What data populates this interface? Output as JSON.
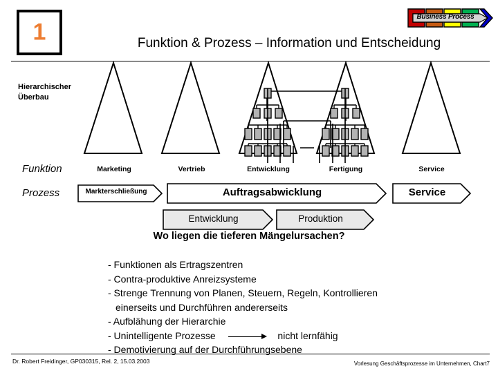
{
  "header": {
    "slide_number": "1",
    "slide_number_color": "#ED7D31",
    "title": "Funktion & Prozess – Information und Entscheidung",
    "logo_text": "Business Process",
    "logo_colors": [
      "#C00000",
      "#C55A11",
      "#FFFF00",
      "#00B050",
      "#0000CC"
    ]
  },
  "diagram": {
    "hierarchy_label": "Hierarchischer\nÜberbau",
    "hierarchy_label_line1": "Hierarchischer",
    "hierarchy_label_line2": "Überbau",
    "row_keys": {
      "function": "Funktion",
      "process": "Prozess"
    },
    "functions": [
      {
        "label": "Marketing",
        "has_orgchart": false
      },
      {
        "label": "Vertrieb",
        "has_orgchart": false
      },
      {
        "label": "Entwicklung",
        "has_orgchart": true
      },
      {
        "label": "Fertigung",
        "has_orgchart": true
      },
      {
        "label": "Service",
        "has_orgchart": false
      }
    ],
    "process_row_1": [
      {
        "label": "Markterschließung",
        "fill": "#ffffff",
        "font_size": "10px"
      },
      {
        "label": "Auftragsabwicklung",
        "fill": "#ffffff",
        "font_size": "15px"
      },
      {
        "label": "Service",
        "fill": "#ffffff",
        "font_size": "15px"
      }
    ],
    "process_row_2": [
      {
        "label": "Entwicklung",
        "fill": "#e9e9e9",
        "font_size": "13.5px"
      },
      {
        "label": "Produktion",
        "fill": "#e9e9e9",
        "font_size": "13.5px"
      }
    ],
    "orgchart_box_fill": "#b3b3b3"
  },
  "body": {
    "question": "Wo liegen die tieferen Mängelursachen?",
    "bullets": [
      {
        "text": "- Funktionen als Ertragszentren",
        "indent": false,
        "arrow_after": null
      },
      {
        "text": "- Contra-produktive Anreizsysteme",
        "indent": false,
        "arrow_after": null
      },
      {
        "text": "- Strenge Trennung von Planen, Steuern, Regeln, Kontrollieren",
        "indent": false,
        "arrow_after": null
      },
      {
        "text": "einerseits und Durchführen andererseits",
        "indent": true,
        "arrow_after": null
      },
      {
        "text": "- Aufblähung der Hierarchie",
        "indent": false,
        "arrow_after": null
      },
      {
        "text": "- Unintelligente Prozesse",
        "indent": false,
        "arrow_after": "nicht lernfähig"
      },
      {
        "text": "- Demotivierung auf der Durchführungsebene",
        "indent": false,
        "arrow_after": null
      }
    ]
  },
  "footer": {
    "left": "Dr. Robert Freidinger, GP030315, Rel. 2, 15.03.2003",
    "right": "Vorlesung Geschäftsprozesse im Unternehmen, Chart7"
  }
}
